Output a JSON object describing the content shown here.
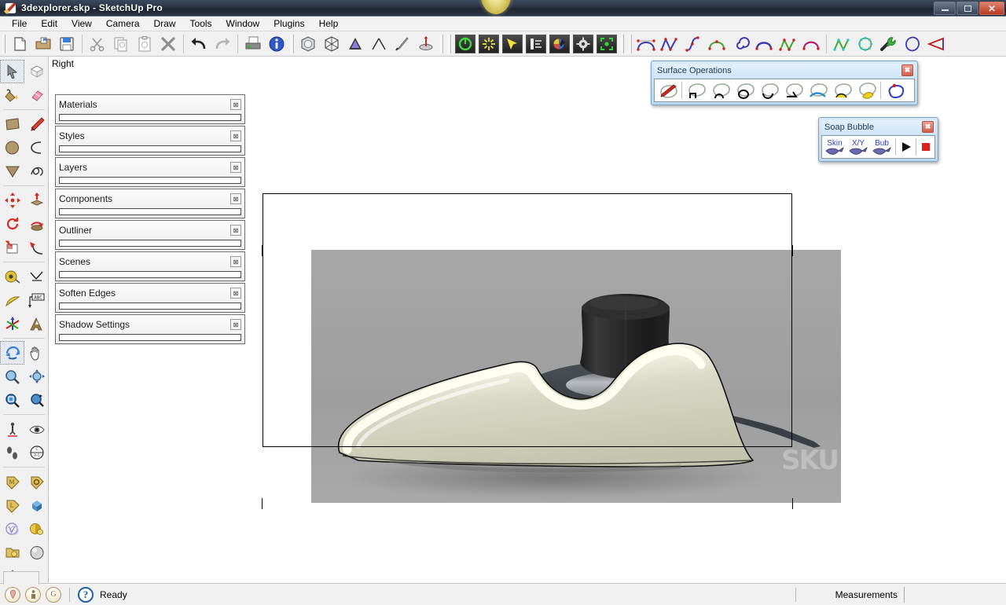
{
  "window": {
    "title": "3dexplorer.skp - SketchUp Pro",
    "app_icon": "sketchup-logo-icon",
    "minimize_label": "",
    "maximize_label": "",
    "close_label": "✕"
  },
  "menubar": {
    "items": [
      {
        "label": "File",
        "accel": "F"
      },
      {
        "label": "Edit",
        "accel": "E"
      },
      {
        "label": "View",
        "accel": "V"
      },
      {
        "label": "Camera",
        "accel": "C"
      },
      {
        "label": "Draw",
        "accel": "r"
      },
      {
        "label": "Tools",
        "accel": "T"
      },
      {
        "label": "Window",
        "accel": "W"
      },
      {
        "label": "Plugins",
        "accel": "P"
      },
      {
        "label": "Help",
        "accel": "H"
      }
    ]
  },
  "toolbar": {
    "standard": [
      {
        "name": "new-document",
        "tip": "New"
      },
      {
        "name": "open-folder",
        "tip": "Open"
      },
      {
        "name": "save-floppy",
        "tip": "Save"
      },
      {
        "name": "cut-scissors",
        "tip": "Cut"
      },
      {
        "name": "copy-pages",
        "tip": "Copy"
      },
      {
        "name": "paste-clipboard",
        "tip": "Paste"
      },
      {
        "name": "erase-x",
        "tip": "Erase"
      },
      {
        "name": "undo-arrow",
        "tip": "Undo"
      },
      {
        "name": "redo-arrow",
        "tip": "Redo"
      },
      {
        "name": "print-printer",
        "tip": "Print"
      },
      {
        "name": "model-info",
        "tip": "Model Info"
      }
    ],
    "solid_tools": [
      {
        "name": "outer-shell-cube",
        "tip": "Outer Shell"
      },
      {
        "name": "intersect-cube",
        "tip": "Intersect"
      },
      {
        "name": "union-cone",
        "tip": "Union"
      },
      {
        "name": "subtract-cone",
        "tip": "Subtract"
      },
      {
        "name": "trim-sword",
        "tip": "Trim"
      },
      {
        "name": "split-disc",
        "tip": "Split"
      }
    ],
    "render": [
      {
        "name": "power-button-icon",
        "color": "#3fc13f"
      },
      {
        "name": "sun-burst-icon",
        "color": "#f2e33c"
      },
      {
        "name": "cursor-arrow-icon",
        "color": "#f2e33c"
      },
      {
        "name": "sliders-icon",
        "color": "#e8e8e8"
      },
      {
        "name": "color-palette-icon",
        "color": "#d94e3e"
      },
      {
        "name": "gear-icon",
        "color": "#e0e0e0"
      },
      {
        "name": "render-region-icon",
        "color": "#32d232"
      }
    ],
    "bezier": [
      {
        "name": "bezier-arc-icon"
      },
      {
        "name": "polyline-icon"
      },
      {
        "name": "s-curve-icon"
      },
      {
        "name": "green-arc-icon"
      },
      {
        "name": "spiral-icon"
      },
      {
        "name": "blue-arc-icon"
      },
      {
        "name": "green-polyline-icon"
      },
      {
        "name": "magenta-arc-icon"
      },
      {
        "name": "cyan-polyline-icon"
      },
      {
        "name": "cyan-circle-icon"
      },
      {
        "name": "wrench-icon"
      },
      {
        "name": "blue-loop-icon"
      },
      {
        "name": "red-pie-icon"
      }
    ]
  },
  "left_palette": {
    "groups": [
      {
        "rows": [
          [
            {
              "name": "select-arrow-tool",
              "selected": true
            },
            {
              "name": "make-component-tool",
              "selected": false
            }
          ],
          [
            {
              "name": "paint-bucket-tool",
              "selected": false
            },
            {
              "name": "eraser-tool",
              "selected": false
            }
          ]
        ]
      },
      {
        "rows": [
          [
            {
              "name": "rectangle-tool",
              "selected": false
            },
            {
              "name": "line-pencil-tool",
              "selected": false
            }
          ],
          [
            {
              "name": "circle-tool",
              "selected": false
            },
            {
              "name": "arc-tool",
              "selected": false
            }
          ],
          [
            {
              "name": "polygon-tool",
              "selected": false
            },
            {
              "name": "freehand-tool",
              "selected": false
            }
          ]
        ]
      },
      {
        "rows": [
          [
            {
              "name": "move-tool",
              "selected": false
            },
            {
              "name": "pushpull-tool",
              "selected": false
            }
          ],
          [
            {
              "name": "rotate-tool",
              "selected": false
            },
            {
              "name": "followme-tool",
              "selected": false
            }
          ],
          [
            {
              "name": "scale-tool",
              "selected": false
            },
            {
              "name": "offset-tool",
              "selected": false
            }
          ]
        ]
      },
      {
        "rows": [
          [
            {
              "name": "tape-measure-tool",
              "selected": false
            },
            {
              "name": "dimension-tool",
              "selected": false
            }
          ],
          [
            {
              "name": "protractor-tool",
              "selected": false
            },
            {
              "name": "text-label-tool",
              "selected": false
            }
          ],
          [
            {
              "name": "axes-tool",
              "selected": false
            },
            {
              "name": "3d-text-tool",
              "selected": false
            }
          ]
        ]
      },
      {
        "rows": [
          [
            {
              "name": "orbit-tool",
              "selected": true
            },
            {
              "name": "pan-hand-tool",
              "selected": false
            }
          ],
          [
            {
              "name": "zoom-tool",
              "selected": false
            },
            {
              "name": "zoom-extents-tool",
              "selected": false
            }
          ],
          [
            {
              "name": "zoom-window-tool",
              "selected": false
            },
            {
              "name": "previous-view-tool",
              "selected": false
            }
          ]
        ]
      },
      {
        "rows": [
          [
            {
              "name": "position-camera-tool",
              "selected": false
            },
            {
              "name": "look-around-tool",
              "selected": false
            }
          ],
          [
            {
              "name": "walk-tool",
              "selected": false
            },
            {
              "name": "section-plane-tool",
              "selected": false
            }
          ]
        ]
      },
      {
        "rows": [
          [
            {
              "name": "material-tag-tool",
              "selected": false
            },
            {
              "name": "object-tag-tool",
              "selected": false
            }
          ],
          [
            {
              "name": "light-tag-tool",
              "selected": false
            },
            {
              "name": "proxy-cube-tool",
              "selected": false
            }
          ],
          [
            {
              "name": "vray-circle-tool",
              "selected": false
            },
            {
              "name": "vray-light-tool",
              "selected": false
            }
          ],
          [
            {
              "name": "vray-folder-tool",
              "selected": false
            },
            {
              "name": "sphere-tool",
              "selected": false
            }
          ],
          [
            {
              "name": "cone-tool",
              "selected": false
            }
          ]
        ]
      }
    ]
  },
  "viewport": {
    "view_label": "Right",
    "watermark": "SKU",
    "background_color": "#a3a3a3"
  },
  "tray": {
    "panels": [
      {
        "title": "Materials",
        "close": "⊠"
      },
      {
        "title": "Styles",
        "close": "⊠"
      },
      {
        "title": "Layers",
        "close": "⊠"
      },
      {
        "title": "Components",
        "close": "⊠"
      },
      {
        "title": "Outliner",
        "close": "⊠"
      },
      {
        "title": "Scenes",
        "close": "⊠"
      },
      {
        "title": "Soften Edges",
        "close": "⊠"
      },
      {
        "title": "Shadow Settings",
        "close": "⊠"
      }
    ]
  },
  "surface_operations": {
    "title": "Surface Operations",
    "close": "✖",
    "buttons": [
      {
        "name": "surface-draw-pencil-icon"
      },
      {
        "name": "surface-square-icon"
      },
      {
        "name": "surface-arc-icon"
      },
      {
        "name": "surface-circle-icon"
      },
      {
        "name": "surface-bowl-icon"
      },
      {
        "name": "surface-wedge-icon"
      },
      {
        "name": "surface-blue-curve-icon"
      },
      {
        "name": "surface-yellow-arc-icon"
      },
      {
        "name": "surface-yellow-fill-icon"
      },
      {
        "name": "surface-blue-outline-icon"
      }
    ]
  },
  "soap_bubble": {
    "title": "Soap Bubble",
    "close": "✖",
    "buttons": [
      {
        "name": "soap-skin-button",
        "label": "Skin"
      },
      {
        "name": "soap-xy-button",
        "label": "X/Y"
      },
      {
        "name": "soap-bub-button",
        "label": "Bub"
      },
      {
        "name": "soap-play-button",
        "label": "▶"
      },
      {
        "name": "soap-stop-button",
        "label": "■"
      }
    ]
  },
  "statusbar": {
    "icons": [
      {
        "name": "geo-location-icon",
        "glyph": "⚲"
      },
      {
        "name": "person-icon",
        "glyph": "ᛁ"
      },
      {
        "name": "google-g-icon",
        "glyph": "G"
      }
    ],
    "help_icon": "question-mark-icon",
    "status_text": "Ready",
    "measurements_label": "Measurements",
    "measurements_value": ""
  }
}
